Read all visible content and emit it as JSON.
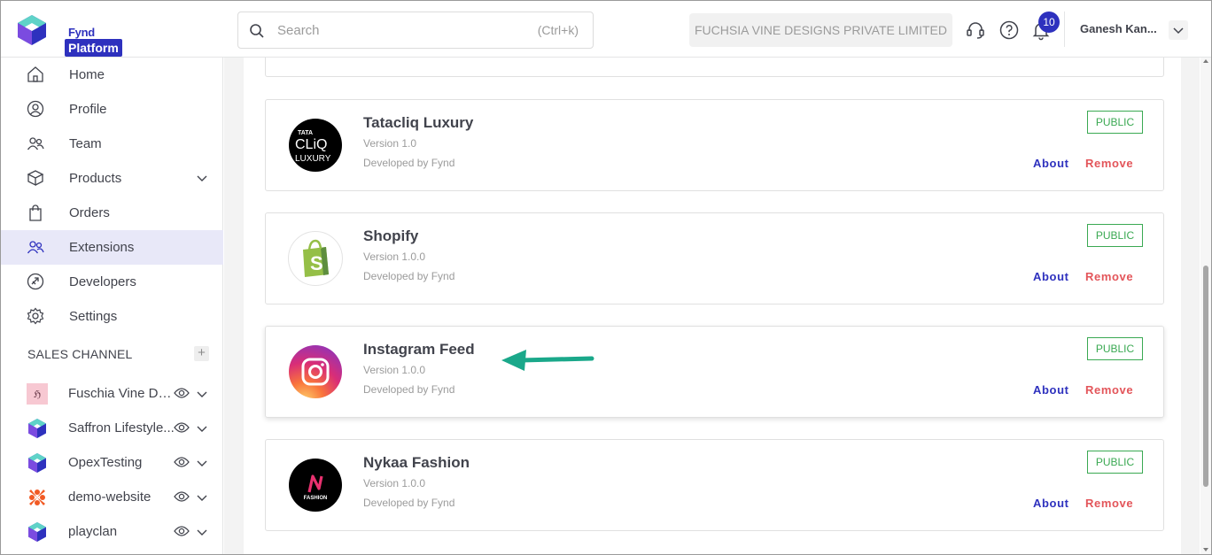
{
  "brand": {
    "top": "Fynd",
    "badge": "Platform"
  },
  "search": {
    "placeholder": "Search",
    "shortcut": "(Ctrl+k)"
  },
  "header": {
    "company": "FUCHSIA VINE DESIGNS PRIVATE LIMITED",
    "notification_count": "10",
    "user_name": "Ganesh Kan..."
  },
  "sidebar": {
    "items": [
      {
        "label": "Home",
        "icon": "home-icon"
      },
      {
        "label": "Profile",
        "icon": "profile-icon"
      },
      {
        "label": "Team",
        "icon": "team-icon"
      },
      {
        "label": "Products",
        "icon": "box-icon"
      },
      {
        "label": "Orders",
        "icon": "bag-icon"
      },
      {
        "label": "Extensions",
        "icon": "extensions-icon"
      },
      {
        "label": "Developers",
        "icon": "developers-icon"
      },
      {
        "label": "Settings",
        "icon": "gear-icon"
      }
    ],
    "sales_channel_title": "SALES CHANNEL",
    "channels": [
      {
        "label": "Fuschia Vine De..."
      },
      {
        "label": "Saffron Lifestyle..."
      },
      {
        "label": "OpexTesting"
      },
      {
        "label": "demo-website"
      },
      {
        "label": "playclan"
      }
    ]
  },
  "extensions": [
    {
      "name": "Tatacliq Luxury",
      "version": "Version 1.0",
      "developer": "Developed by Fynd",
      "badge": "PUBLIC",
      "about": "About",
      "remove": "Remove",
      "logo_text_top": "TATA",
      "logo_text_mid": "CLiQ",
      "logo_text_bot": "LUXURY"
    },
    {
      "name": "Shopify",
      "version": "Version 1.0.0",
      "developer": "Developed by Fynd",
      "badge": "PUBLIC",
      "about": "About",
      "remove": "Remove"
    },
    {
      "name": "Instagram Feed",
      "version": "Version 1.0.0",
      "developer": "Developed by Fynd",
      "badge": "PUBLIC",
      "about": "About",
      "remove": "Remove"
    },
    {
      "name": "Nykaa Fashion",
      "version": "Version 1.0.0",
      "developer": "Developed by Fynd",
      "badge": "PUBLIC",
      "about": "About",
      "remove": "Remove",
      "logo_text": "FASHION"
    }
  ],
  "colors": {
    "accent": "#2e31be",
    "public_green": "#3aa952",
    "remove_red": "#e3555a",
    "arrow": "#1aa88a",
    "active_nav_bg": "#e8e8f8"
  }
}
